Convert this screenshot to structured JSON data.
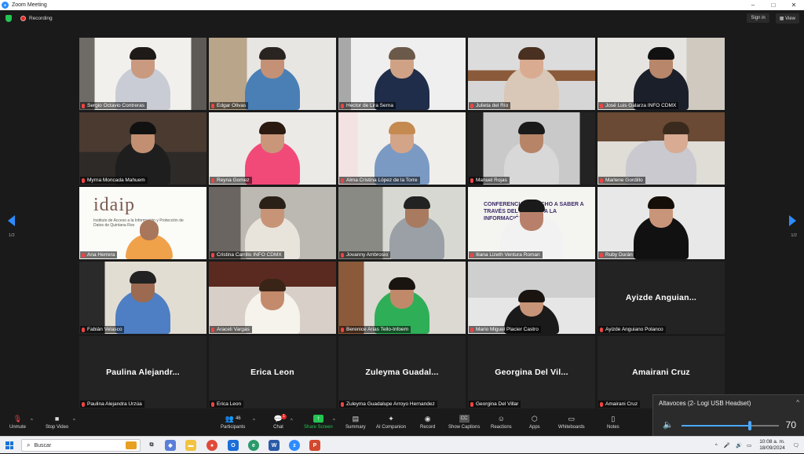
{
  "window": {
    "title": "Zoom Meeting",
    "minimize": "–",
    "maximize": "□",
    "close": "✕"
  },
  "topbar": {
    "recording": "Recording",
    "sign_in": "Sign in",
    "view": "View"
  },
  "gallery": {
    "page_indicator_left": "1/2",
    "page_indicator_right": "1/2",
    "tiles": [
      {
        "name": "Sergio Octavio Contreras"
      },
      {
        "name": "Edgar Olivas"
      },
      {
        "name": "Hector de Lira Serna"
      },
      {
        "name": "Julieta del Río"
      },
      {
        "name": "José Luis Galarza INFO CDMX"
      },
      {
        "name": "Myrna Moncada Mahuem"
      },
      {
        "name": "Reyna Gomez"
      },
      {
        "name": "Alma Cristina López de la Torre"
      },
      {
        "name": "Manuel Rojas"
      },
      {
        "name": "Marlene Gordillo"
      },
      {
        "name": "Ana Herrera",
        "logo_text": "idaip",
        "logo_small": "Instituto de Acceso a la Información y Protección de Datos de Quintana Roo"
      },
      {
        "name": "Cristina Carrillo INFO CDMX"
      },
      {
        "name": "Jovanny Ambrosio"
      },
      {
        "name": "Iliana Lizeth Ventura Roman",
        "banner": "CONFERENCIA DERECHO A SABER A TRAVÉS DEL ACCESO A LA INFORMACIÓN"
      },
      {
        "name": "Ruby Durán"
      },
      {
        "name": "Fabián Velasco"
      },
      {
        "name": "Araceli Vargas"
      },
      {
        "name": "Berenice Arias Tello-Infoem"
      },
      {
        "name": "Mario Miguel Placier Castro"
      },
      {
        "name": "Ayizde Anguiano Polanco",
        "display": "Ayizde  Anguian..."
      },
      {
        "name": "Paulina Alejandra Urzúa",
        "display": "Paulina  Alejandr..."
      },
      {
        "name": "Erica Leon",
        "display": "Erica Leon"
      },
      {
        "name": "Zuleyma Guadalupe Arroyo Hernandez",
        "display": "Zuleyma  Guadal..."
      },
      {
        "name": "Georgina Del Villar",
        "display": "Georgina  Del  Vil..."
      },
      {
        "name": "Amairani Cruz",
        "display": "Amairani Cruz"
      }
    ]
  },
  "toolbar": {
    "unmute": "Unmute",
    "stop_video": "Stop Video",
    "participants": "Participants",
    "participants_count": "46",
    "chat": "Chat",
    "chat_badge": "1",
    "share_screen": "Share Screen",
    "summary": "Summary",
    "ai_companion": "AI Companion",
    "record": "Record",
    "show_captions": "Show Captions",
    "reactions": "Reactions",
    "apps": "Apps",
    "whiteboards": "Whiteboards",
    "notes": "Notes"
  },
  "volume": {
    "device": "Altavoces (2- Logi USB Headset)",
    "level": 70
  },
  "taskbar": {
    "search_placeholder": "Buscar",
    "time": "10:08 a. m.",
    "date": "18/09/2024"
  },
  "colors": {
    "zoom_blue": "#2d8cff",
    "share_green": "#23c552",
    "record_red": "#e02828",
    "active_speaker": "#9ee04a"
  }
}
